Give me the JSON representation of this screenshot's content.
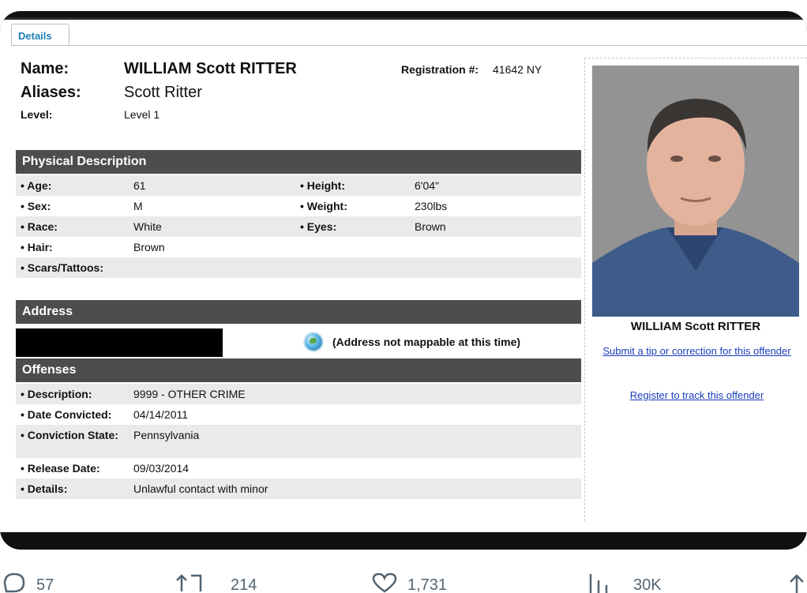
{
  "tab": {
    "label": "Details"
  },
  "header": {
    "name_label": "Name:",
    "name_value": "WILLIAM Scott RITTER",
    "registration_label": "Registration #:",
    "registration_value": "41642 NY",
    "aliases_label": "Aliases:",
    "aliases_value": "Scott Ritter",
    "level_label": "Level:",
    "level_value": "Level 1"
  },
  "physical": {
    "title": "Physical Description",
    "rows": [
      {
        "k": "• Age:",
        "v": "61",
        "k2": "• Height:",
        "v2": "6'04\""
      },
      {
        "k": "• Sex:",
        "v": "M",
        "k2": "• Weight:",
        "v2": "230lbs"
      },
      {
        "k": "• Race:",
        "v": "White",
        "k2": "• Eyes:",
        "v2": "Brown"
      },
      {
        "k": "• Hair:",
        "v": "Brown",
        "k2": "",
        "v2": ""
      },
      {
        "k": "• Scars/Tattoos:",
        "v": "",
        "k2": "",
        "v2": ""
      }
    ]
  },
  "address": {
    "title": "Address",
    "map_note": "(Address not mappable at this time)"
  },
  "offenses": {
    "title": "Offenses",
    "rows": [
      {
        "k": "• Description:",
        "v": "9999 - OTHER CRIME"
      },
      {
        "k": "• Date Convicted:",
        "v": "04/14/2011"
      },
      {
        "k": "• Conviction State:",
        "v": "Pennsylvania"
      },
      {
        "k": "• Release Date:",
        "v": "09/03/2014"
      },
      {
        "k": "• Details:",
        "v": "Unlawful contact with minor"
      }
    ]
  },
  "panel": {
    "caption": "WILLIAM Scott RITTER",
    "tip_link": "Submit a tip or correction for this offender",
    "track_link": "Register to track this offender"
  },
  "actions": {
    "replies": "57",
    "reposts": "214",
    "likes": "1,731",
    "views": "30K"
  },
  "colors": {
    "section_bar": "#4d4d4d",
    "link": "#1a3dbb",
    "tab_text": "#1f7fb4"
  }
}
